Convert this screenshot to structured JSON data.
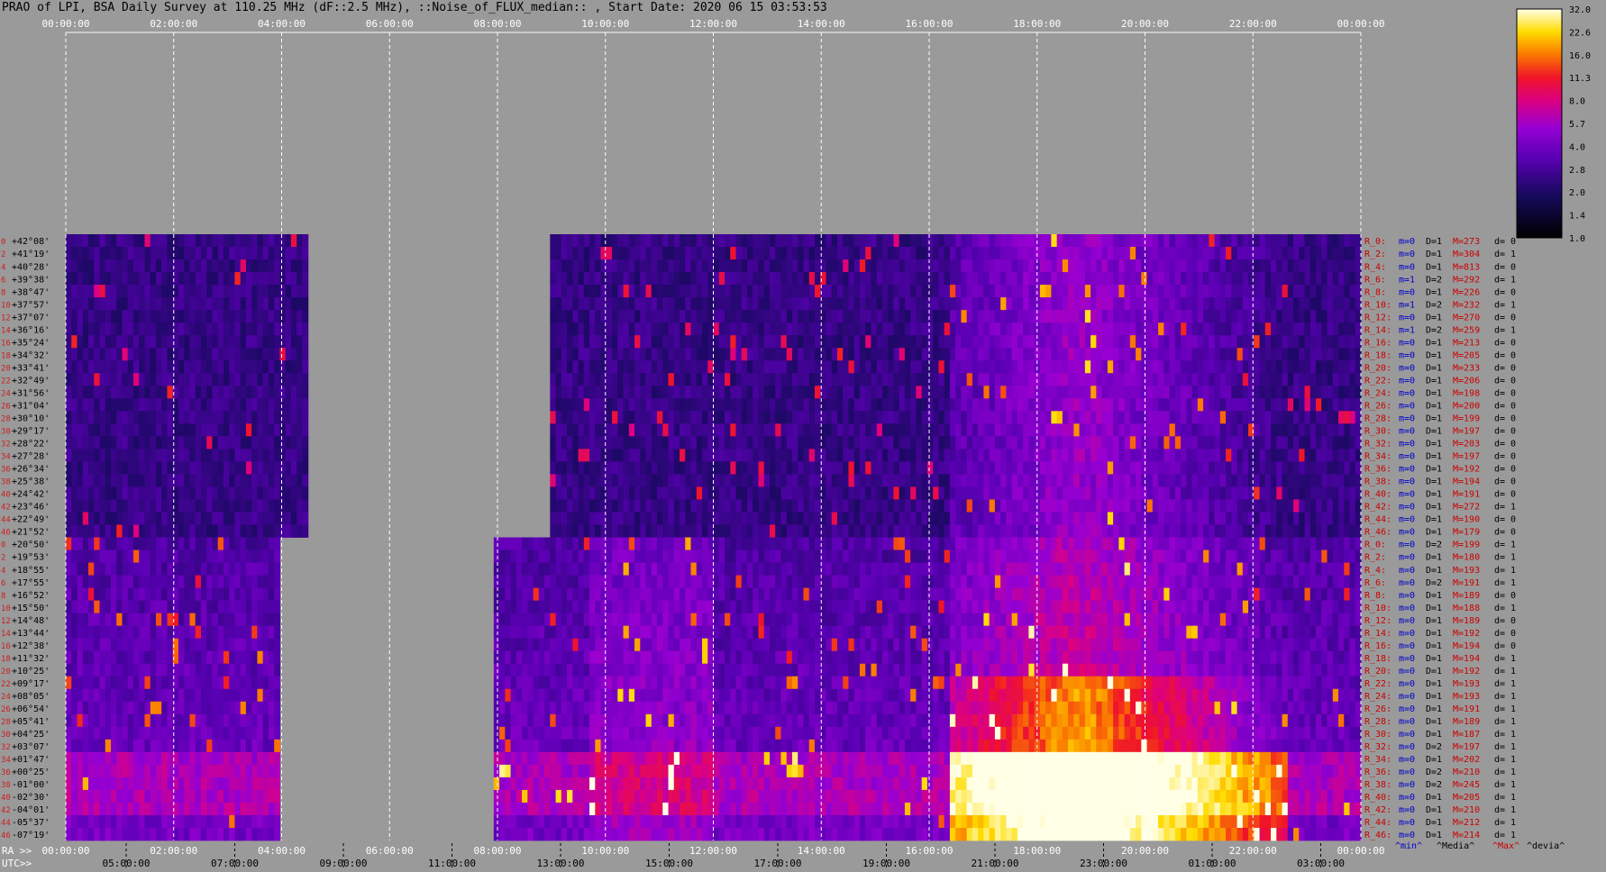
{
  "title": "PRAO of LPI, BSA Daily Survey at 110.25 MHz (dF::2.5 MHz), ::Noise_of_FLUX_median:: , Start Date: 2020 06 15 03:53:53",
  "chart_data": {
    "type": "heatmap",
    "title": "PRAO of LPI, BSA Daily Survey at 110.25 MHz (dF::2.5 MHz), ::Noise_of_FLUX_median:: , Start Date: 2020 06 15 03:53:53",
    "x_top_ticks": [
      "00:00:00",
      "02:00:00",
      "04:00:00",
      "06:00:00",
      "08:00:00",
      "10:00:00",
      "12:00:00",
      "14:00:00",
      "16:00:00",
      "18:00:00",
      "20:00:00",
      "22:00:00",
      "00:00:00"
    ],
    "x_bottom_ra_label": "RA >>",
    "x_bottom_ra_ticks": [
      "00:00:00",
      "02:00:00",
      "04:00:00",
      "06:00:00",
      "08:00:00",
      "10:00:00",
      "12:00:00",
      "14:00:00",
      "16:00:00",
      "18:00:00",
      "20:00:00",
      "22:00:00",
      "00:00:00"
    ],
    "x_bottom_utc_label": "UTC>>",
    "x_bottom_utc_ticks": [
      "05:00:00",
      "07:00:00",
      "09:00:00",
      "11:00:00",
      "13:00:00",
      "15:00:00",
      "17:00:00",
      "19:00:00",
      "21:00:00",
      "23:00:00",
      "01:00:00",
      "03:00:00"
    ],
    "colorbar": {
      "ticks": [
        "32.0",
        "22.6",
        "16.0",
        "11.3",
        "8.0",
        "5.7",
        "4.0",
        "2.8",
        "2.0",
        "1.4",
        "1.0"
      ],
      "range": [
        1.0,
        32.0
      ],
      "scale": "log"
    },
    "y_dec_labels": [
      "+42°08'",
      "+41°19'",
      "+40°28'",
      "+39°38'",
      "+38°47'",
      "+37°57'",
      "+37°07'",
      "+36°16'",
      "+35°24'",
      "+34°32'",
      "+33°41'",
      "+32°49'",
      "+31°56'",
      "+31°04'",
      "+30°10'",
      "+29°17'",
      "+28°22'",
      "+27°28'",
      "+26°34'",
      "+25°38'",
      "+24°42'",
      "+23°46'",
      "+22°49'",
      "+21°52'",
      "+20°50'",
      "+19°53'",
      "+18°55'",
      "+17°55'",
      "+16°52'",
      "+15°50'",
      "+14°48'",
      "+13°44'",
      "+12°38'",
      "+11°32'",
      "+10°25'",
      "+09°17'",
      "+08°05'",
      "+06°54'",
      "+05°41'",
      "+04°25'",
      "+03°07'",
      "+01°47'",
      "+00°25'",
      "-01°00'",
      "-02°30'",
      "-04°01'",
      "-05°37'",
      "-07°19'"
    ],
    "y_idx_labels": [
      "0",
      "2",
      "4",
      "6",
      "8",
      "10",
      "12",
      "14",
      "16",
      "18",
      "20",
      "22",
      "24",
      "26",
      "28",
      "30",
      "32",
      "34",
      "36",
      "38",
      "40",
      "42",
      "44",
      "46",
      "0",
      "2",
      "4",
      "6",
      "8",
      "10",
      "12",
      "14",
      "16",
      "18",
      "20",
      "22",
      "24",
      "26",
      "28",
      "30",
      "32",
      "34",
      "36",
      "38",
      "40",
      "42",
      "44",
      "46"
    ],
    "right_rows": [
      [
        "R_0:",
        "m=0",
        "D=1",
        "M=273",
        "d= 0"
      ],
      [
        "R_2:",
        "m=0",
        "D=1",
        "M=304",
        "d= 1"
      ],
      [
        "R_4:",
        "m=0",
        "D=1",
        "M=813",
        "d= 0"
      ],
      [
        "R_6:",
        "m=1",
        "D=2",
        "M=292",
        "d= 1"
      ],
      [
        "R_8:",
        "m=0",
        "D=1",
        "M=226",
        "d= 0"
      ],
      [
        "R_10:",
        "m=1",
        "D=2",
        "M=232",
        "d= 1"
      ],
      [
        "R_12:",
        "m=0",
        "D=1",
        "M=270",
        "d= 0"
      ],
      [
        "R_14:",
        "m=1",
        "D=2",
        "M=259",
        "d= 1"
      ],
      [
        "R_16:",
        "m=0",
        "D=1",
        "M=213",
        "d= 0"
      ],
      [
        "R_18:",
        "m=0",
        "D=1",
        "M=205",
        "d= 0"
      ],
      [
        "R_20:",
        "m=0",
        "D=1",
        "M=233",
        "d= 0"
      ],
      [
        "R_22:",
        "m=0",
        "D=1",
        "M=206",
        "d= 0"
      ],
      [
        "R_24:",
        "m=0",
        "D=1",
        "M=198",
        "d= 0"
      ],
      [
        "R_26:",
        "m=0",
        "D=1",
        "M=200",
        "d= 0"
      ],
      [
        "R_28:",
        "m=0",
        "D=1",
        "M=199",
        "d= 0"
      ],
      [
        "R_30:",
        "m=0",
        "D=1",
        "M=197",
        "d= 0"
      ],
      [
        "R_32:",
        "m=0",
        "D=1",
        "M=203",
        "d= 0"
      ],
      [
        "R_34:",
        "m=0",
        "D=1",
        "M=197",
        "d= 0"
      ],
      [
        "R_36:",
        "m=0",
        "D=1",
        "M=192",
        "d= 0"
      ],
      [
        "R_38:",
        "m=0",
        "D=1",
        "M=194",
        "d= 0"
      ],
      [
        "R_40:",
        "m=0",
        "D=1",
        "M=191",
        "d= 0"
      ],
      [
        "R_42:",
        "m=0",
        "D=1",
        "M=272",
        "d= 1"
      ],
      [
        "R_44:",
        "m=0",
        "D=1",
        "M=190",
        "d= 0"
      ],
      [
        "R_46:",
        "m=0",
        "D=1",
        "M=179",
        "d= 0"
      ],
      [
        "R_0:",
        "m=0",
        "D=2",
        "M=199",
        "d= 1"
      ],
      [
        "R_2:",
        "m=0",
        "D=1",
        "M=180",
        "d= 1"
      ],
      [
        "R_4:",
        "m=0",
        "D=1",
        "M=193",
        "d= 1"
      ],
      [
        "R_6:",
        "m=0",
        "D=2",
        "M=191",
        "d= 1"
      ],
      [
        "R_8:",
        "m=0",
        "D=1",
        "M=189",
        "d= 0"
      ],
      [
        "R_10:",
        "m=0",
        "D=1",
        "M=188",
        "d= 1"
      ],
      [
        "R_12:",
        "m=0",
        "D=1",
        "M=189",
        "d= 0"
      ],
      [
        "R_14:",
        "m=0",
        "D=1",
        "M=192",
        "d= 0"
      ],
      [
        "R_16:",
        "m=0",
        "D=1",
        "M=194",
        "d= 0"
      ],
      [
        "R_18:",
        "m=0",
        "D=1",
        "M=194",
        "d= 1"
      ],
      [
        "R_20:",
        "m=0",
        "D=1",
        "M=192",
        "d= 1"
      ],
      [
        "R_22:",
        "m=0",
        "D=1",
        "M=193",
        "d= 1"
      ],
      [
        "R_24:",
        "m=0",
        "D=1",
        "M=193",
        "d= 1"
      ],
      [
        "R_26:",
        "m=0",
        "D=1",
        "M=191",
        "d= 1"
      ],
      [
        "R_28:",
        "m=0",
        "D=1",
        "M=189",
        "d= 1"
      ],
      [
        "R_30:",
        "m=0",
        "D=1",
        "M=187",
        "d= 1"
      ],
      [
        "R_32:",
        "m=0",
        "D=2",
        "M=197",
        "d= 1"
      ],
      [
        "R_34:",
        "m=0",
        "D=1",
        "M=202",
        "d= 1"
      ],
      [
        "R_36:",
        "m=0",
        "D=2",
        "M=210",
        "d= 1"
      ],
      [
        "R_38:",
        "m=0",
        "D=2",
        "M=245",
        "d= 1"
      ],
      [
        "R_40:",
        "m=0",
        "D=1",
        "M=205",
        "d= 1"
      ],
      [
        "R_42:",
        "m=0",
        "D=1",
        "M=210",
        "d= 1"
      ],
      [
        "R_44:",
        "m=0",
        "D=1",
        "M=212",
        "d= 1"
      ],
      [
        "R_46:",
        "m=0",
        "D=1",
        "M=214",
        "d= 1"
      ]
    ],
    "footer_legend": [
      "^min^",
      "^Media^",
      "^Max^",
      "^devia^"
    ],
    "colors": {
      "background": "#9a9a9a",
      "grid": "#ffffff",
      "index_label": "#cc2020",
      "dec_label": "#000000",
      "row_name": "#cc0000",
      "min_label": "#0000cc",
      "max_label": "#cc0000",
      "media_label": "#000000",
      "devia_label": "#000000"
    }
  }
}
